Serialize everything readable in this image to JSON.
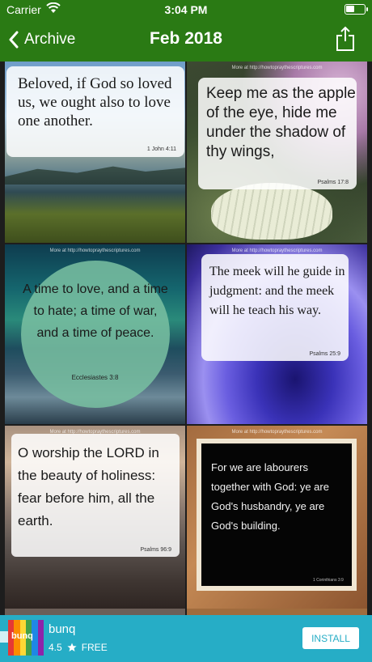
{
  "status_bar": {
    "carrier": "Carrier",
    "time": "3:04 PM"
  },
  "nav": {
    "back_label": "Archive",
    "title": "Feb 2018"
  },
  "tiles": [
    {
      "quote": "Beloved, if God so loved us, we ought also to love one another.",
      "reference": "1 John 4:11",
      "url": ""
    },
    {
      "quote": "Keep me as the apple of the eye, hide me under the shadow of thy wings,",
      "reference": "Psalms 17:8",
      "url": "More at http://howtopraythescriptures.com"
    },
    {
      "quote": "A time to love, and a time to hate; a time of war, and a time of peace.",
      "reference": "Ecclesiastes 3:8",
      "url": "More at http://howtopraythescriptures.com"
    },
    {
      "quote": "The meek will he guide in judgment: and the meek will he teach his way.",
      "reference": "Psalms 25:9",
      "url": "More at http://howtopraythescriptures.com"
    },
    {
      "quote": "O worship the LORD in the beauty of holiness: fear before him, all the earth.",
      "reference": "Psalms 96:9",
      "url": "More at http://howtopraythescriptures.com"
    },
    {
      "quote": "For we are labourers together with God: ye are God's husbandry, ye are God's building.",
      "reference": "1 Corinthians 3:9",
      "url": "More at http://howtopraythescriptures.com"
    }
  ],
  "ad": {
    "brand": "bunq",
    "logo_text": "bunq",
    "rating": "4.5",
    "price": "FREE",
    "cta": "INSTALL"
  },
  "colors": {
    "nav_green": "#2a7a14",
    "ad_teal": "#26adc6"
  },
  "icons": {
    "back": "chevron-left-icon",
    "share": "share-icon",
    "wifi": "wifi-icon",
    "battery": "battery-icon",
    "star": "star-icon"
  }
}
